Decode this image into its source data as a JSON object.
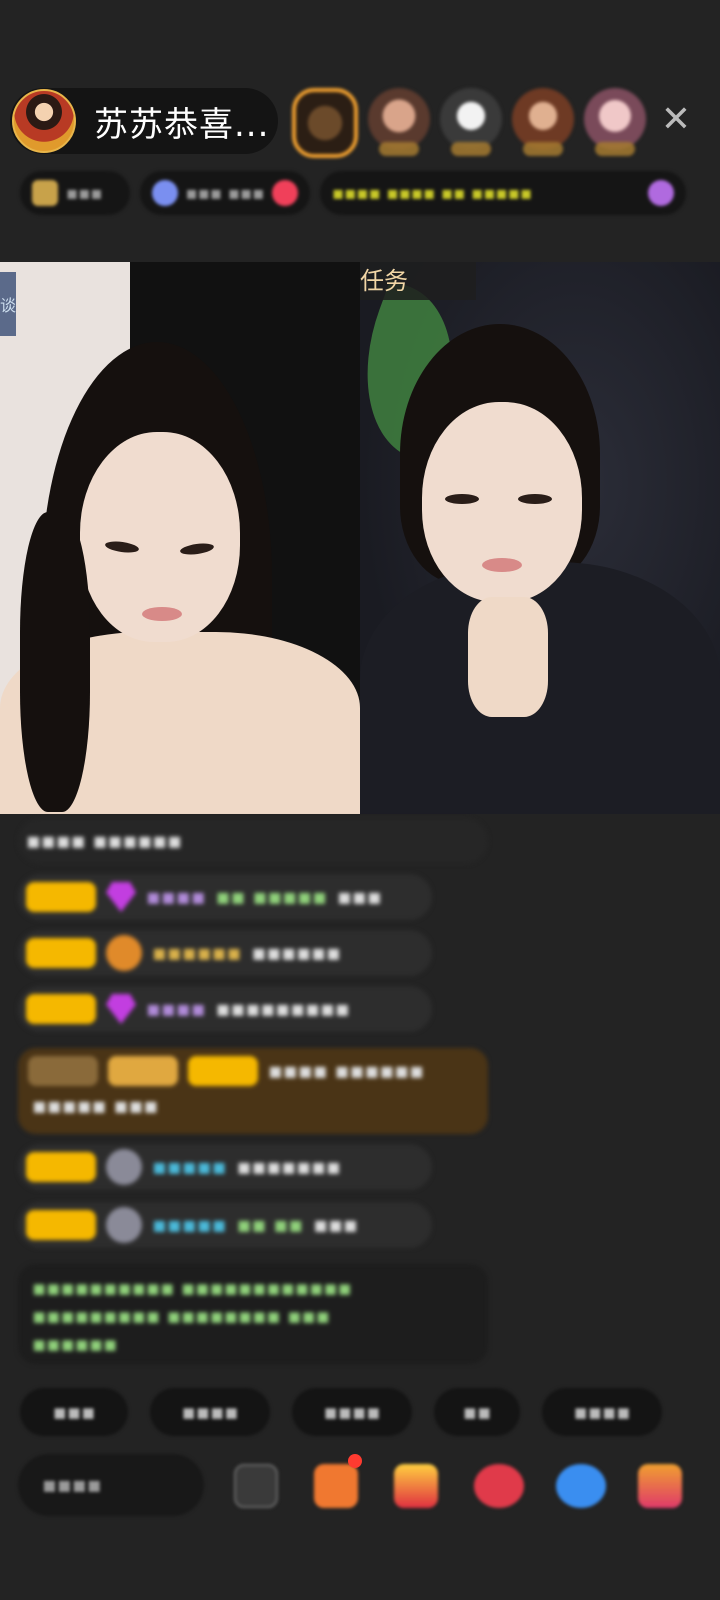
{
  "header": {
    "host_name": "苏苏恭喜...",
    "close_symbol": "✕"
  },
  "video": {
    "left_tag": "谈",
    "right_tag": "任务"
  },
  "colors": {
    "background": "#232323",
    "level_badge": "#f5b800",
    "notice_text": "#8fd07a",
    "accent_red": "#ff3b30"
  }
}
